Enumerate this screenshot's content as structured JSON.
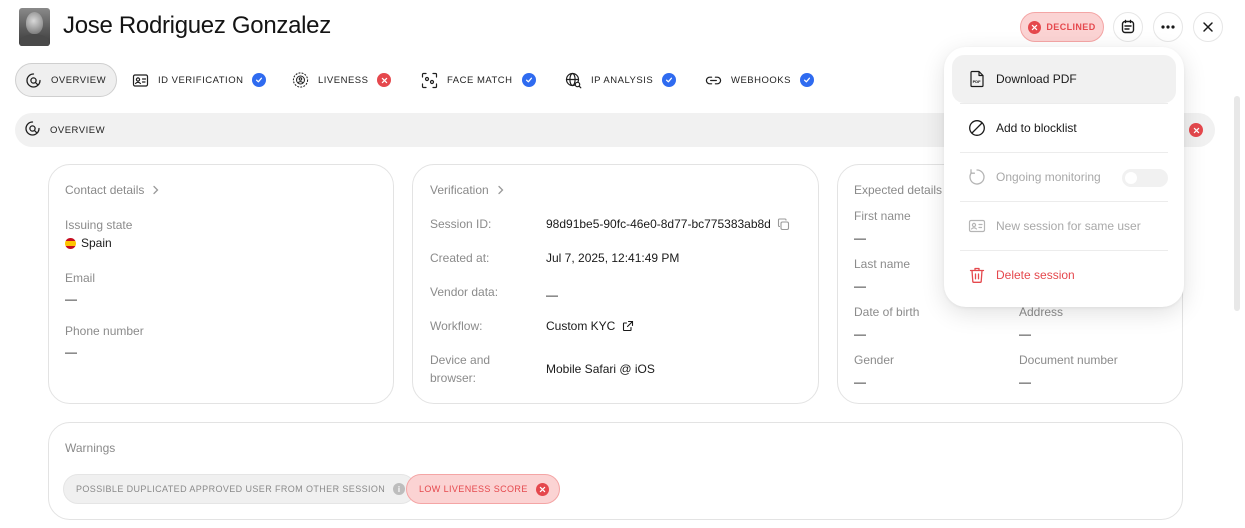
{
  "header": {
    "user_name": "Jose Rodriguez Gonzalez",
    "status": "DECLINED",
    "colors": {
      "declined_bg": "#fbd3d3",
      "declined_text": "#e5484d",
      "ok_badge": "#2f6bf0",
      "danger": "#e5484d"
    }
  },
  "tabs": [
    {
      "label": "OVERVIEW",
      "icon": "overview-icon",
      "status": "none",
      "active": true
    },
    {
      "label": "ID VERIFICATION",
      "icon": "id-card-icon",
      "status": "approved"
    },
    {
      "label": "LIVENESS",
      "icon": "liveness-icon",
      "status": "declined"
    },
    {
      "label": "FACE MATCH",
      "icon": "face-match-icon",
      "status": "approved"
    },
    {
      "label": "IP ANALYSIS",
      "icon": "globe-search-icon",
      "status": "approved"
    },
    {
      "label": "WEBHOOKS",
      "icon": "link-icon",
      "status": "approved"
    }
  ],
  "section": {
    "label": "OVERVIEW",
    "status": "declined"
  },
  "contact": {
    "title": "Contact details",
    "issuing_state_label": "Issuing state",
    "issuing_state_value": "Spain",
    "email_label": "Email",
    "email_value": "—",
    "phone_label": "Phone number",
    "phone_value": "—"
  },
  "verification": {
    "title": "Verification",
    "session_id_label": "Session ID:",
    "session_id_value": "98d91be5-90fc-46e0-8d77-bc775383ab8d",
    "created_label": "Created at:",
    "created_value": "Jul 7, 2025, 12:41:49 PM",
    "vendor_label": "Vendor data:",
    "vendor_value": "—",
    "workflow_label": "Workflow:",
    "workflow_value": "Custom KYC",
    "device_label_1": "Device and",
    "device_label_2": "browser:",
    "device_value": "Mobile Safari @ iOS"
  },
  "expected": {
    "title": "Expected details",
    "first_name_label": "First name",
    "first_name_value": "—",
    "last_name_label": "Last name",
    "last_name_value": "—",
    "dob_label": "Date of birth",
    "dob_value": "—",
    "address_label": "Address",
    "address_value": "—",
    "gender_label": "Gender",
    "gender_value": "—",
    "doc_number_label": "Document number",
    "doc_number_value": "—"
  },
  "warnings": {
    "title": "Warnings",
    "items": [
      {
        "label": "POSSIBLE DUPLICATED APPROVED USER FROM OTHER SESSION",
        "severity": "info"
      },
      {
        "label": "LOW LIVENESS SCORE",
        "severity": "error"
      }
    ]
  },
  "menu": {
    "download_pdf": "Download PDF",
    "add_blocklist": "Add to blocklist",
    "ongoing_monitoring": "Ongoing monitoring",
    "ongoing_monitoring_enabled": false,
    "new_session": "New session for same user",
    "delete_session": "Delete session"
  }
}
